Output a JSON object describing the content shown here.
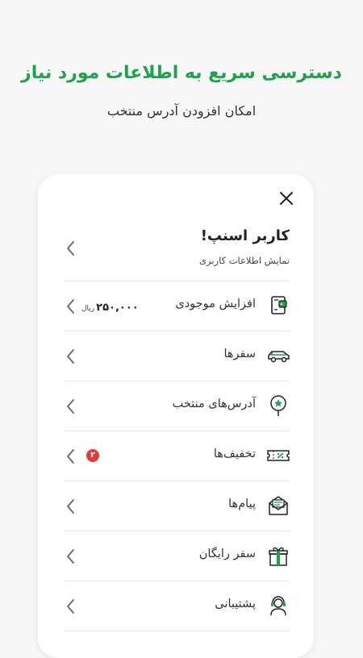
{
  "header": {
    "title": "دسترسی سریع به اطلاعات مورد نیاز",
    "subtitle": "امکان افزودن آدرس منتخب"
  },
  "colors": {
    "accent": "#1fa34a",
    "badge": "#e53935",
    "text": "#333333"
  },
  "drawer": {
    "close_icon": "close-icon",
    "profile": {
      "name": "کاربر اسنپ!",
      "subtitle": "نمایش اطلاعات کاربری"
    },
    "items": [
      {
        "label": "افزایش موجودی",
        "icon": "wallet-icon",
        "value": "۲۵۰,۰۰۰",
        "unit": "ریال"
      },
      {
        "label": "سفرها",
        "icon": "car-icon"
      },
      {
        "label": "آدرس‌های منتخب",
        "icon": "location-star-icon"
      },
      {
        "label": "تخفیف‌ها",
        "icon": "discount-icon",
        "badge": "۲"
      },
      {
        "label": "پیام‌ها",
        "icon": "mail-icon"
      },
      {
        "label": "سفر رایگان",
        "icon": "gift-icon"
      },
      {
        "label": "پشتیبانی",
        "icon": "support-icon"
      }
    ]
  }
}
